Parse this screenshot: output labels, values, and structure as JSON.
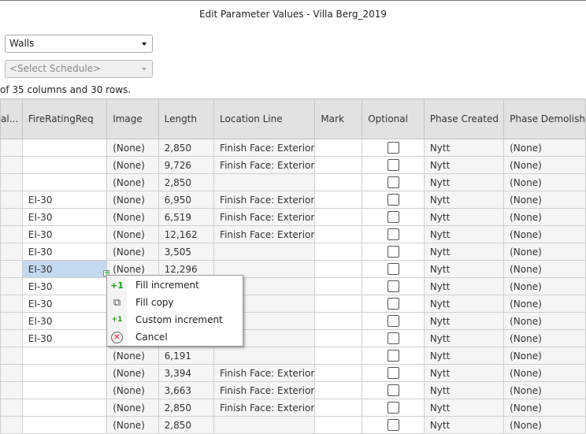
{
  "window": {
    "title": "Edit Parameter Values - Villa Berg_2019"
  },
  "category_select": {
    "value": "Walls"
  },
  "schedule_select": {
    "placeholder": "<Select Schedule>"
  },
  "info_text": "of 35 columns and 30 rows.",
  "columns": [
    "al...",
    "FireRatingReq",
    "Image",
    "Length",
    "Location Line",
    "Mark",
    "Optional",
    "Phase Created",
    "Phase Demolish"
  ],
  "rows": [
    {
      "fire": "",
      "image": "(None)",
      "length": "2,850",
      "location": "Finish Face: Exterior",
      "mark": "",
      "optional": false,
      "phase_created": "Nytt",
      "phase_demolished": "(None)"
    },
    {
      "fire": "",
      "image": "(None)",
      "length": "9,726",
      "location": "Finish Face: Exterior",
      "mark": "",
      "optional": false,
      "phase_created": "Nytt",
      "phase_demolished": "(None)"
    },
    {
      "fire": "",
      "image": "(None)",
      "length": "2,850",
      "location": "",
      "mark": "",
      "optional": false,
      "phase_created": "Nytt",
      "phase_demolished": "(None)"
    },
    {
      "fire": "EI-30",
      "image": "(None)",
      "length": "6,950",
      "location": "Finish Face: Exterior",
      "mark": "",
      "optional": false,
      "phase_created": "Nytt",
      "phase_demolished": "(None)"
    },
    {
      "fire": "EI-30",
      "image": "(None)",
      "length": "6,519",
      "location": "Finish Face: Exterior",
      "mark": "",
      "optional": false,
      "phase_created": "Nytt",
      "phase_demolished": "(None)"
    },
    {
      "fire": "EI-30",
      "image": "(None)",
      "length": "12,162",
      "location": "Finish Face: Exterior",
      "mark": "",
      "optional": false,
      "phase_created": "Nytt",
      "phase_demolished": "(None)"
    },
    {
      "fire": "EI-30",
      "image": "(None)",
      "length": "3,505",
      "location": "",
      "mark": "",
      "optional": false,
      "phase_created": "Nytt",
      "phase_demolished": "(None)"
    },
    {
      "fire": "EI-30",
      "image": "(None)",
      "length": "12,296",
      "location": "",
      "mark": "",
      "optional": false,
      "phase_created": "Nytt",
      "phase_demolished": "(None)",
      "selected": true
    },
    {
      "fire": "EI-30",
      "image": "",
      "length": "",
      "location": "",
      "mark": "",
      "optional": false,
      "phase_created": "Nytt",
      "phase_demolished": "(None)"
    },
    {
      "fire": "EI-30",
      "image": "",
      "length": "",
      "location": "",
      "mark": "",
      "optional": false,
      "phase_created": "Nytt",
      "phase_demolished": "(None)"
    },
    {
      "fire": "EI-30",
      "image": "",
      "length": "",
      "location": "",
      "mark": "",
      "optional": false,
      "phase_created": "Nytt",
      "phase_demolished": "(None)"
    },
    {
      "fire": "EI-30",
      "image": "",
      "length": "",
      "location": "",
      "mark": "",
      "optional": false,
      "phase_created": "Nytt",
      "phase_demolished": "(None)"
    },
    {
      "fire": "",
      "image": "(None)",
      "length": "6,191",
      "location": "",
      "mark": "",
      "optional": false,
      "phase_created": "Nytt",
      "phase_demolished": "(None)"
    },
    {
      "fire": "",
      "image": "(None)",
      "length": "3,394",
      "location": "Finish Face: Exterior",
      "mark": "",
      "optional": false,
      "phase_created": "Nytt",
      "phase_demolished": "(None)"
    },
    {
      "fire": "",
      "image": "(None)",
      "length": "3,663",
      "location": "Finish Face: Exterior",
      "mark": "",
      "optional": false,
      "phase_created": "Nytt",
      "phase_demolished": "(None)"
    },
    {
      "fire": "",
      "image": "(None)",
      "length": "2,850",
      "location": "Finish Face: Exterior",
      "mark": "",
      "optional": false,
      "phase_created": "Nytt",
      "phase_demolished": "(None)"
    },
    {
      "fire": "",
      "image": "(None)",
      "length": "2,850",
      "location": "",
      "mark": "",
      "optional": false,
      "phase_created": "Nytt",
      "phase_demolished": "(None)"
    }
  ],
  "context_menu": {
    "items": [
      {
        "label": "Fill increment",
        "icon": "plus-one-icon",
        "glyph": "+1"
      },
      {
        "label": "Fill copy",
        "icon": "copy-icon",
        "glyph": "⧉"
      },
      {
        "label": "Custom increment",
        "icon": "custom-increment-icon",
        "glyph": "+1"
      },
      {
        "label": "Cancel",
        "icon": "cancel-icon",
        "glyph": "✕"
      }
    ]
  }
}
